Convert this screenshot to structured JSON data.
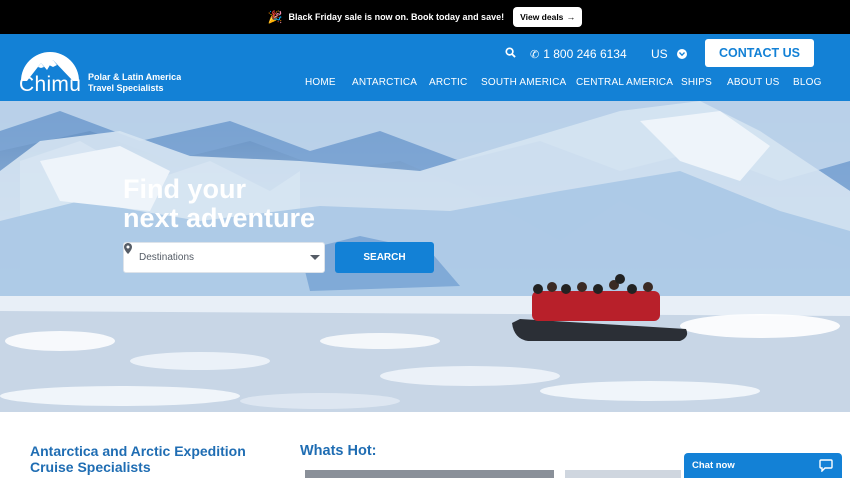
{
  "promo": {
    "message": "Black Friday sale is now on. Book today and save!",
    "button_label": "View deals"
  },
  "header": {
    "logo_text": "Chimu",
    "tagline_line1": "Polar & Latin America",
    "tagline_line2": "Travel Specialists",
    "phone": "1 800 246 6134",
    "region": "US",
    "contact_label": "CONTACT US",
    "nav": [
      "HOME",
      "ANTARCTICA",
      "ARCTIC",
      "SOUTH AMERICA",
      "CENTRAL AMERICA",
      "SHIPS",
      "ABOUT US",
      "BLOG"
    ]
  },
  "hero": {
    "title_line1": "Find your",
    "title_line2": "next adventure",
    "destinations_placeholder": "Destinations",
    "search_label": "SEARCH"
  },
  "content": {
    "intro_heading": "Antarctica and Arctic Expedition Cruise Specialists",
    "whats_hot_heading": "Whats Hot:"
  },
  "chat": {
    "label": "Chat now"
  },
  "colors": {
    "brand_blue": "#1381d6",
    "heading_blue": "#1f6db3",
    "promo_bg": "#000000"
  },
  "icons": [
    "party-popper-icon",
    "arrow-right-icon",
    "search-icon",
    "phone-icon",
    "chevron-down-icon",
    "map-pin-icon",
    "chat-bubble-icon",
    "mountain-logo-icon"
  ]
}
